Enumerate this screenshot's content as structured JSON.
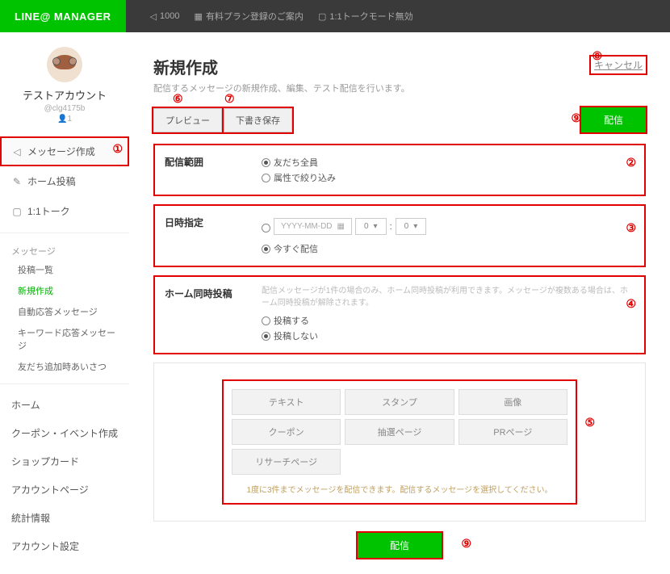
{
  "header": {
    "logo": "LINE@ MANAGER",
    "points": "1000",
    "plan_link": "有料プラン登録のご案内",
    "talk_mode": "1:1トークモード無効"
  },
  "account": {
    "name": "テストアカウント",
    "id": "@clg4175b",
    "friends": "1"
  },
  "sidebar": {
    "nav": [
      {
        "label": "メッセージ作成"
      },
      {
        "label": "ホーム投稿"
      },
      {
        "label": "1:1トーク"
      }
    ],
    "section_message": {
      "title": "メッセージ",
      "items": [
        "投稿一覧",
        "新規作成",
        "自動応答メッセージ",
        "キーワード応答メッセージ",
        "友だち追加時あいさつ"
      ]
    },
    "bottom_links": [
      "ホーム",
      "クーポン・イベント作成",
      "ショップカード",
      "アカウントページ",
      "統計情報",
      "アカウント設定"
    ]
  },
  "page": {
    "title": "新規作成",
    "subtitle": "配信するメッセージの新規作成、編集、テスト配信を行います。",
    "cancel": "キャンセル",
    "preview_btn": "プレビュー",
    "draft_btn": "下書き保存",
    "send_btn": "配信"
  },
  "form": {
    "range": {
      "label": "配信範囲",
      "opt_all": "友だち全員",
      "opt_filter": "属性で絞り込み"
    },
    "datetime": {
      "label": "日時指定",
      "date_placeholder": "YYYY-MM-DD",
      "hour": "0",
      "minute": "0",
      "opt_now": "今すぐ配信"
    },
    "home_post": {
      "label": "ホーム同時投稿",
      "hint": "配信メッセージが1件の場合のみ、ホーム同時投稿が利用できます。メッセージが複数ある場合は、ホーム同時投稿が解除されます。",
      "opt_yes": "投稿する",
      "opt_no": "投稿しない"
    }
  },
  "message_types": {
    "buttons": [
      "テキスト",
      "スタンプ",
      "画像",
      "クーポン",
      "抽選ページ",
      "PRページ",
      "リサーチページ"
    ],
    "note": "1度に3件までメッセージを配信できます。配信するメッセージを選択してください。"
  },
  "annotations": {
    "a1": "①",
    "a2": "②",
    "a3": "③",
    "a4": "④",
    "a5": "⑤",
    "a6": "⑥",
    "a7": "⑦",
    "a8": "⑧",
    "a9": "⑨"
  }
}
